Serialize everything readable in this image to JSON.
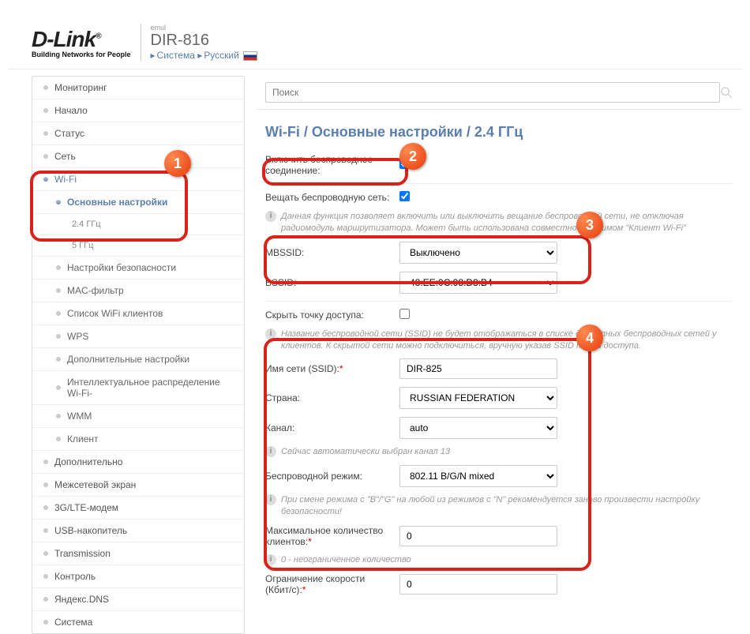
{
  "header": {
    "brand": "D-Link",
    "reg": "®",
    "tagline": "Building Networks for People",
    "emul": "emul",
    "model": "DIR-816",
    "bc_system": "Система",
    "bc_lang": "Русский"
  },
  "search": {
    "placeholder": "Поиск"
  },
  "sidebar": {
    "monitoring": "Мониторинг",
    "start": "Начало",
    "status": "Статус",
    "network": "Сеть",
    "wifi": "Wi-Fi",
    "basic": "Основные настройки",
    "g24": "2.4 ГГц",
    "g5": "5 ГГц",
    "security": "Настройки безопасности",
    "macfilter": "MAC-фильтр",
    "clients": "Список WiFi клиентов",
    "wps": "WPS",
    "additional_wifi": "Дополнительные настройки",
    "intel": "Интеллектуальное распределение Wi-Fi-",
    "wmm": "WMM",
    "client": "Клиент",
    "advanced_top": "Дополнительно",
    "firewall": "Межсетевой экран",
    "modem": "3G/LTE-модем",
    "usb": "USB-накопитель",
    "transmission": "Transmission",
    "control": "Контроль",
    "yandex": "Яндекс.DNS",
    "system": "Система"
  },
  "page": {
    "title": "Wi-Fi /  Основные настройки  /  2.4 ГГц",
    "enable_label": "Включить беспроводное соединение:",
    "broadcast_label": "Вещать беспроводную сеть:",
    "broadcast_note": "Данная функция позволяет включить или выключить вещание беспроводной сети, не отключая радиомодуль маршрутизатора. Может быть использована совместно с режимом \"Клиент Wi-Fi\"",
    "mbssid_label": "MBSSID:",
    "mbssid_value": "Выключено",
    "bssid_label": "BSSID:",
    "bssid_value": "48:EE:0C:98:D8:B4",
    "hide_ap_label": "Скрыть точку доступа:",
    "hide_ap_note": "Название беспроводной сети (SSID) не будет отображаться в списке доступных беспроводных сетей у клиентов. К скрытой сети можно подключиться, вручную указав SSID точки доступа.",
    "ssid_label": "Имя сети (SSID):",
    "ssid_value": "DIR-825",
    "country_label": "Страна:",
    "country_value": "RUSSIAN FEDERATION",
    "channel_label": "Канал:",
    "channel_value": "auto",
    "channel_note": "Сейчас автоматически выбран канал 13",
    "mode_label": "Беспроводной режим:",
    "mode_value": "802.11 B/G/N mixed",
    "mode_note": "При смене режима с \"B\"/\"G\" на любой из режимов с \"N\" рекомендуется заново произвести настройку безопасности!",
    "maxclients_label": "Максимальное количество клиентов:",
    "maxclients_value": "0",
    "maxclients_note": "0 - неограниченное количество",
    "ratelimit_label": "Ограничение скорости (Кбит/c):",
    "ratelimit_value": "0"
  },
  "callouts": {
    "c1": "1",
    "c2": "2",
    "c3": "3",
    "c4": "4"
  }
}
